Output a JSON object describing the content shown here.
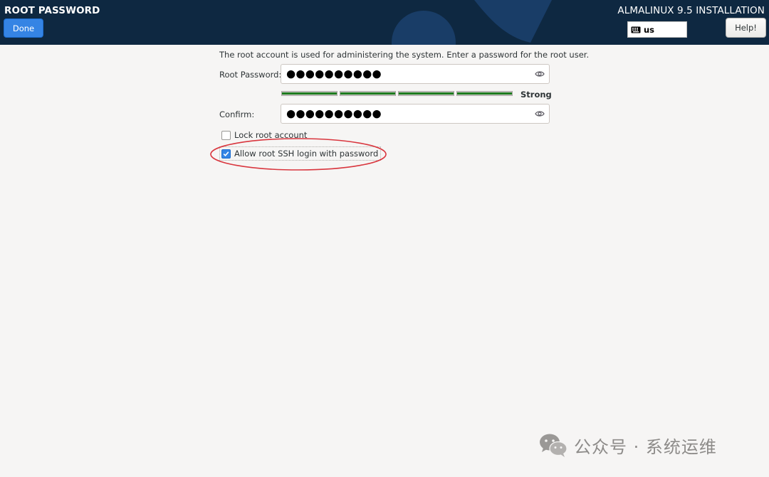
{
  "header": {
    "page_title": "ROOT PASSWORD",
    "done_label": "Done",
    "install_title": "ALMALINUX 9.5 INSTALLATION",
    "keyboard_layout": "us",
    "help_label": "Help!",
    "background_color": "#0e2841",
    "accent_color": "#3584e4"
  },
  "form": {
    "description": "The root account is used for administering the system.  Enter a password for the root user.",
    "root_password_label": "Root Password:",
    "root_password_value": "●●●●●●●●●●",
    "confirm_label": "Confirm:",
    "confirm_value": "●●●●●●●●●●",
    "show_password_icon": "eye-icon",
    "strength": {
      "label": "Strong",
      "segments_filled": 4,
      "segments_total": 4,
      "fill_color": "#1e7b1e"
    },
    "lock_root": {
      "label": "Lock root account",
      "checked": false
    },
    "allow_ssh": {
      "label": "Allow root SSH login with password",
      "checked": true
    }
  },
  "annotation": {
    "color": "#d9363e",
    "shape": "ellipse"
  },
  "watermark": {
    "text": "公众号 · 系统运维",
    "icon": "wechat-logo"
  }
}
